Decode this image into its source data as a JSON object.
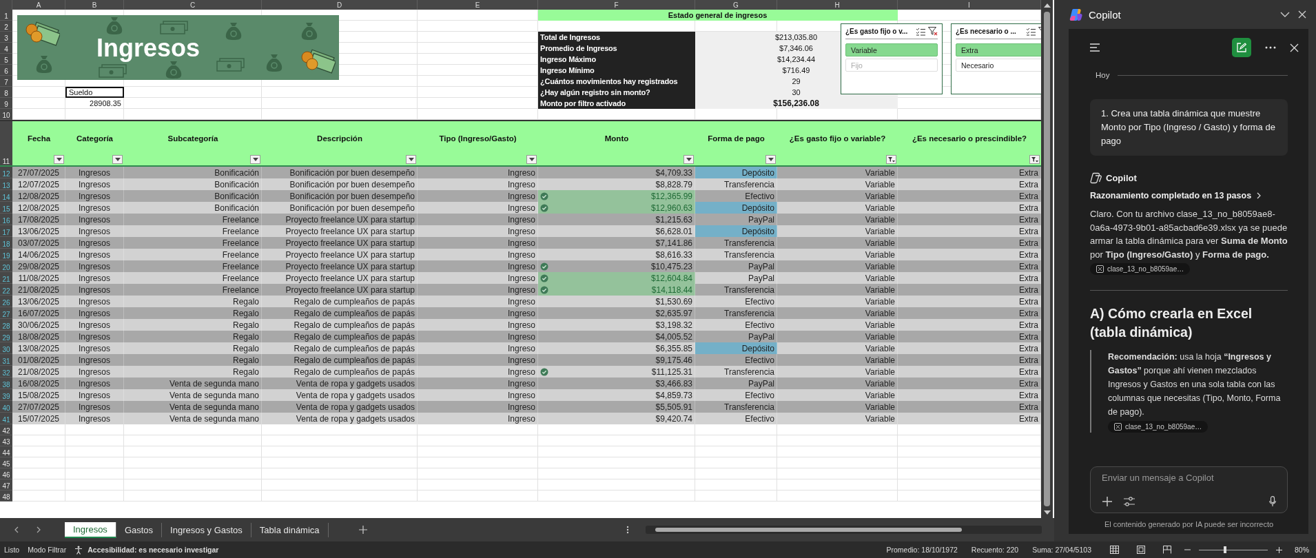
{
  "sheet": {
    "column_letters": [
      "A",
      "B",
      "C",
      "D",
      "E",
      "F",
      "G",
      "H",
      "I"
    ],
    "top_rows": [
      "1",
      "2",
      "3",
      "4",
      "5",
      "6",
      "7",
      "8",
      "9",
      "10"
    ],
    "banner": {
      "title": "Ingresos"
    },
    "b_cells": [
      {
        "text": "Sueldo",
        "selected": true
      },
      {
        "text": "28908.35",
        "selected": false
      }
    ],
    "bottom_rows": [
      "42",
      "43",
      "44",
      "45",
      "46",
      "47",
      "48"
    ]
  },
  "summary": {
    "title": "Estado general de ingresos",
    "rows": [
      {
        "label": "Total de Ingresos",
        "value": "$213,035.80",
        "bold": false
      },
      {
        "label": "Promedio de Ingresos",
        "value": "$7,346.06",
        "bold": false
      },
      {
        "label": "Ingreso Máximo",
        "value": "$14,234.44",
        "bold": false
      },
      {
        "label": "Ingreso Mínimo",
        "value": "$716.49",
        "bold": false
      },
      {
        "label": "¿Cuántos movimientos hay registrados",
        "value": "29",
        "bold": false
      },
      {
        "label": "¿Hay algún registro sin monto?",
        "value": "30",
        "bold": false
      },
      {
        "label": "Monto por filtro activado",
        "value": "$156,236.08",
        "bold": true
      }
    ]
  },
  "slicers": [
    {
      "title": "¿Es gasto fijo o v...",
      "items": [
        {
          "label": "Variable",
          "selected": true,
          "available": true
        },
        {
          "label": "Fijo",
          "selected": false,
          "available": false
        }
      ]
    },
    {
      "title": "¿Es necesario o ...",
      "items": [
        {
          "label": "Extra",
          "selected": true,
          "available": true
        },
        {
          "label": "Necesario",
          "selected": false,
          "available": true
        }
      ]
    }
  ],
  "table": {
    "header_row": "11",
    "columns": [
      {
        "label": "Fecha",
        "filtered": false
      },
      {
        "label": "Categoría",
        "filtered": false
      },
      {
        "label": "Subcategoría",
        "filtered": false
      },
      {
        "label": "Descripción",
        "filtered": false
      },
      {
        "label": "Tipo (Ingreso/Gasto)",
        "filtered": false
      },
      {
        "label": "Monto",
        "filtered": false
      },
      {
        "label": "Forma de pago",
        "filtered": false
      },
      {
        "label": "¿Es gasto fijo o variable?",
        "filtered": true
      },
      {
        "label": "¿Es necesario o prescindible?",
        "filtered": true
      }
    ],
    "rows": [
      {
        "row": "12",
        "date": "27/07/2025",
        "category": "Ingresos",
        "subcategory": "Bonificación",
        "description": "Bonificación por buen desempeño",
        "type": "Ingreso",
        "flag": false,
        "amount": "$4,709.33",
        "amount_highlight": false,
        "payment": "Depósito",
        "payment_highlight": true,
        "fixed_variable": "Variable",
        "necessity": "Extra"
      },
      {
        "row": "13",
        "date": "12/07/2025",
        "category": "Ingresos",
        "subcategory": "Bonificación",
        "description": "Bonificación por buen desempeño",
        "type": "Ingreso",
        "flag": false,
        "amount": "$8,828.79",
        "amount_highlight": false,
        "payment": "Transferencia",
        "payment_highlight": false,
        "fixed_variable": "Variable",
        "necessity": "Extra"
      },
      {
        "row": "14",
        "date": "12/08/2025",
        "category": "Ingresos",
        "subcategory": "Bonificación",
        "description": "Bonificación por buen desempeño",
        "type": "Ingreso",
        "flag": true,
        "amount": "$12,365.99",
        "amount_highlight": true,
        "payment": "Efectivo",
        "payment_highlight": false,
        "fixed_variable": "Variable",
        "necessity": "Extra"
      },
      {
        "row": "15",
        "date": "12/08/2025",
        "category": "Ingresos",
        "subcategory": "Bonificación",
        "description": "Bonificación por buen desempeño",
        "type": "Ingreso",
        "flag": true,
        "amount": "$12,960.63",
        "amount_highlight": true,
        "payment": "Depósito",
        "payment_highlight": true,
        "fixed_variable": "Variable",
        "necessity": "Extra"
      },
      {
        "row": "16",
        "date": "17/08/2025",
        "category": "Ingresos",
        "subcategory": "Freelance",
        "description": "Proyecto freelance UX para startup",
        "type": "Ingreso",
        "flag": false,
        "amount": "$1,215.63",
        "amount_highlight": false,
        "payment": "PayPal",
        "payment_highlight": false,
        "fixed_variable": "Variable",
        "necessity": "Extra"
      },
      {
        "row": "17",
        "date": "13/06/2025",
        "category": "Ingresos",
        "subcategory": "Freelance",
        "description": "Proyecto freelance UX para startup",
        "type": "Ingreso",
        "flag": false,
        "amount": "$6,628.01",
        "amount_highlight": false,
        "payment": "Depósito",
        "payment_highlight": true,
        "fixed_variable": "Variable",
        "necessity": "Extra"
      },
      {
        "row": "18",
        "date": "03/07/2025",
        "category": "Ingresos",
        "subcategory": "Freelance",
        "description": "Proyecto freelance UX para startup",
        "type": "Ingreso",
        "flag": false,
        "amount": "$7,141.86",
        "amount_highlight": false,
        "payment": "Transferencia",
        "payment_highlight": false,
        "fixed_variable": "Variable",
        "necessity": "Extra"
      },
      {
        "row": "19",
        "date": "14/06/2025",
        "category": "Ingresos",
        "subcategory": "Freelance",
        "description": "Proyecto freelance UX para startup",
        "type": "Ingreso",
        "flag": false,
        "amount": "$8,616.33",
        "amount_highlight": false,
        "payment": "Transferencia",
        "payment_highlight": false,
        "fixed_variable": "Variable",
        "necessity": "Extra"
      },
      {
        "row": "20",
        "date": "29/08/2025",
        "category": "Ingresos",
        "subcategory": "Freelance",
        "description": "Proyecto freelance UX para startup",
        "type": "Ingreso",
        "flag": true,
        "amount": "$10,475.23",
        "amount_highlight": false,
        "payment": "PayPal",
        "payment_highlight": false,
        "fixed_variable": "Variable",
        "necessity": "Extra"
      },
      {
        "row": "21",
        "date": "11/08/2025",
        "category": "Ingresos",
        "subcategory": "Freelance",
        "description": "Proyecto freelance UX para startup",
        "type": "Ingreso",
        "flag": true,
        "amount": "$12,604.84",
        "amount_highlight": true,
        "payment": "PayPal",
        "payment_highlight": false,
        "fixed_variable": "Variable",
        "necessity": "Extra"
      },
      {
        "row": "22",
        "date": "21/08/2025",
        "category": "Ingresos",
        "subcategory": "Freelance",
        "description": "Proyecto freelance UX para startup",
        "type": "Ingreso",
        "flag": true,
        "amount": "$14,118.44",
        "amount_highlight": true,
        "payment": "Transferencia",
        "payment_highlight": false,
        "fixed_variable": "Variable",
        "necessity": "Extra"
      },
      {
        "row": "26",
        "date": "13/06/2025",
        "category": "Ingresos",
        "subcategory": "Regalo",
        "description": "Regalo de cumpleaños de papás",
        "type": "Ingreso",
        "flag": false,
        "amount": "$1,530.69",
        "amount_highlight": false,
        "payment": "Efectivo",
        "payment_highlight": false,
        "fixed_variable": "Variable",
        "necessity": "Extra"
      },
      {
        "row": "27",
        "date": "16/07/2025",
        "category": "Ingresos",
        "subcategory": "Regalo",
        "description": "Regalo de cumpleaños de papás",
        "type": "Ingreso",
        "flag": false,
        "amount": "$2,635.97",
        "amount_highlight": false,
        "payment": "Transferencia",
        "payment_highlight": false,
        "fixed_variable": "Variable",
        "necessity": "Extra"
      },
      {
        "row": "28",
        "date": "30/06/2025",
        "category": "Ingresos",
        "subcategory": "Regalo",
        "description": "Regalo de cumpleaños de papás",
        "type": "Ingreso",
        "flag": false,
        "amount": "$3,198.32",
        "amount_highlight": false,
        "payment": "Efectivo",
        "payment_highlight": false,
        "fixed_variable": "Variable",
        "necessity": "Extra"
      },
      {
        "row": "29",
        "date": "18/08/2025",
        "category": "Ingresos",
        "subcategory": "Regalo",
        "description": "Regalo de cumpleaños de papás",
        "type": "Ingreso",
        "flag": false,
        "amount": "$4,005.52",
        "amount_highlight": false,
        "payment": "PayPal",
        "payment_highlight": false,
        "fixed_variable": "Variable",
        "necessity": "Extra"
      },
      {
        "row": "30",
        "date": "13/08/2025",
        "category": "Ingresos",
        "subcategory": "Regalo",
        "description": "Regalo de cumpleaños de papás",
        "type": "Ingreso",
        "flag": false,
        "amount": "$6,355.85",
        "amount_highlight": false,
        "payment": "Depósito",
        "payment_highlight": true,
        "fixed_variable": "Variable",
        "necessity": "Extra"
      },
      {
        "row": "31",
        "date": "01/08/2025",
        "category": "Ingresos",
        "subcategory": "Regalo",
        "description": "Regalo de cumpleaños de papás",
        "type": "Ingreso",
        "flag": false,
        "amount": "$9,175.46",
        "amount_highlight": false,
        "payment": "Efectivo",
        "payment_highlight": false,
        "fixed_variable": "Variable",
        "necessity": "Extra"
      },
      {
        "row": "32",
        "date": "21/08/2025",
        "category": "Ingresos",
        "subcategory": "Regalo",
        "description": "Regalo de cumpleaños de papás",
        "type": "Ingreso",
        "flag": true,
        "amount": "$11,125.31",
        "amount_highlight": false,
        "payment": "Transferencia",
        "payment_highlight": false,
        "fixed_variable": "Variable",
        "necessity": "Extra"
      },
      {
        "row": "38",
        "date": "16/08/2025",
        "category": "Ingresos",
        "subcategory": "Venta de segunda mano",
        "description": "Venta de ropa y gadgets usados",
        "type": "Ingreso",
        "flag": false,
        "amount": "$3,466.83",
        "amount_highlight": false,
        "payment": "PayPal",
        "payment_highlight": false,
        "fixed_variable": "Variable",
        "necessity": "Extra"
      },
      {
        "row": "39",
        "date": "15/08/2025",
        "category": "Ingresos",
        "subcategory": "Venta de segunda mano",
        "description": "Venta de ropa y gadgets usados",
        "type": "Ingreso",
        "flag": false,
        "amount": "$4,859.73",
        "amount_highlight": false,
        "payment": "Efectivo",
        "payment_highlight": false,
        "fixed_variable": "Variable",
        "necessity": "Extra"
      },
      {
        "row": "40",
        "date": "27/07/2025",
        "category": "Ingresos",
        "subcategory": "Venta de segunda mano",
        "description": "Venta de ropa y gadgets usados",
        "type": "Ingreso",
        "flag": false,
        "amount": "$5,505.91",
        "amount_highlight": false,
        "payment": "Transferencia",
        "payment_highlight": false,
        "fixed_variable": "Variable",
        "necessity": "Extra"
      },
      {
        "row": "41",
        "date": "15/07/2025",
        "category": "Ingresos",
        "subcategory": "Venta de segunda mano",
        "description": "Venta de ropa y gadgets usados",
        "type": "Ingreso",
        "flag": false,
        "amount": "$9,420.74",
        "amount_highlight": false,
        "payment": "Efectivo",
        "payment_highlight": false,
        "fixed_variable": "Variable",
        "necessity": "Extra"
      }
    ]
  },
  "sheet_tabs": [
    {
      "label": "Ingresos",
      "selected": true
    },
    {
      "label": "Gastos",
      "selected": false
    },
    {
      "label": "Ingresos y Gastos",
      "selected": false
    },
    {
      "label": "Tabla dinámica",
      "selected": false
    }
  ],
  "status_bar": {
    "left": [
      "Listo",
      "Modo Filtrar"
    ],
    "accessibility": "Accesibilidad: es necesario investigar",
    "stats": [
      "Promedio: 18/10/1972",
      "Recuento: 220",
      "Suma: 27/04/5103"
    ],
    "zoom": {
      "level": 0.38,
      "label": "80%"
    }
  },
  "copilot": {
    "title": "Copilot",
    "date_divider": "Hoy",
    "user_message": "1. Crea una tabla dinámica que muestre Monto por Tipo (Ingreso / Gasto) y forma de pago",
    "assistant_name": "Copilot",
    "reasoning": "Razonamiento completado en 13 pasos",
    "answer": "Claro. Con tu archivo clase_13_no_b8059ae8-0a6a-4973-9b01-a85acbad6e39.xlsx ya se puede armar la tabla dinámica para ver **Suma de Monto** por **Tipo (Ingreso/Gasto)** y **Forma de pago.**",
    "answer_attachment": "clase_13_no_b8059ae…",
    "heading": "A) Cómo crearla en Excel (tabla dinámica)",
    "tip": "**Recomendación:** usa la hoja **“Ingresos y Gastos”** porque ahí vienen mezclados Ingresos y Gastos en una sola tabla con las columnas que necesitas (Tipo, Monto, Forma de pago).",
    "tip_attachment": "clase_13_no_b8059ae…",
    "input_placeholder": "Enviar un mensaje a Copilot",
    "disclaimer": "El contenido generado por IA puede ser incorrecto"
  }
}
